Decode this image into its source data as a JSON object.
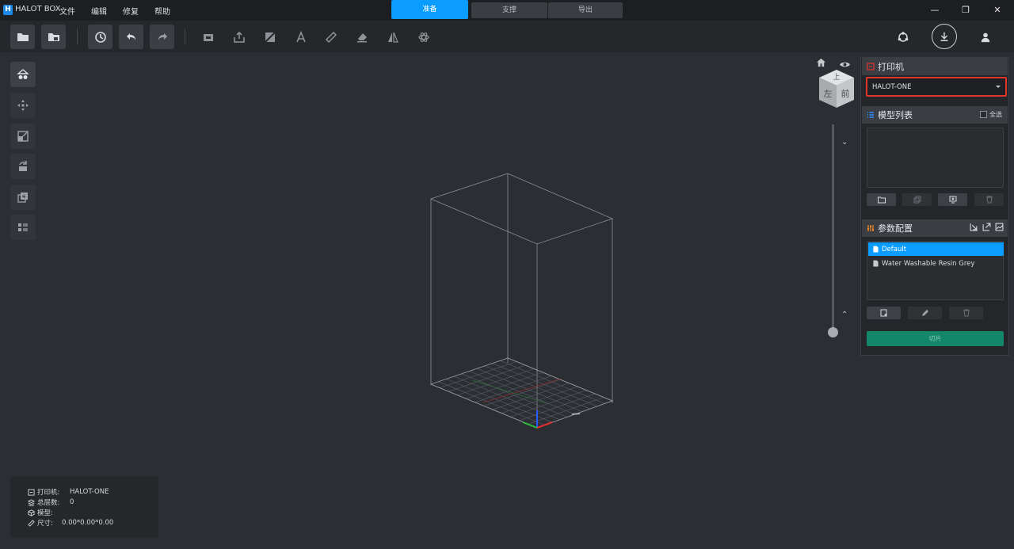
{
  "app": {
    "logo_text": "H",
    "name": "HALOT BOX"
  },
  "menu": {
    "file": "文件",
    "edit": "编辑",
    "repair": "修复",
    "help": "帮助"
  },
  "mode_tabs": {
    "prepare": "准备",
    "support": "支撑",
    "export": "导出"
  },
  "window_controls": {
    "minimize": "—",
    "restore": "❐",
    "close": "✕"
  },
  "view_cube": {
    "top": "上",
    "left": "左",
    "front": "前"
  },
  "printer_panel": {
    "title": "打印机",
    "selected_printer": "HALOT-ONE"
  },
  "model_panel": {
    "title": "模型列表",
    "select_all": "全选"
  },
  "profile_panel": {
    "title": "参数配置",
    "profiles": [
      "Default",
      "Water Washable Resin Grey"
    ],
    "selected_index": 0
  },
  "slice_button": "切片",
  "info": {
    "printer_label": "打印机:",
    "printer_value": "HALOT-ONE",
    "layers_label": "总层数:",
    "layers_value": "0",
    "model_label": "模型:",
    "model_value": "",
    "size_label": "尺寸:",
    "size_value": "0.00*0.00*0.00"
  },
  "colors": {
    "accent": "#0a9cff",
    "slice": "#13876a",
    "highlight_border": "#e0352b"
  }
}
